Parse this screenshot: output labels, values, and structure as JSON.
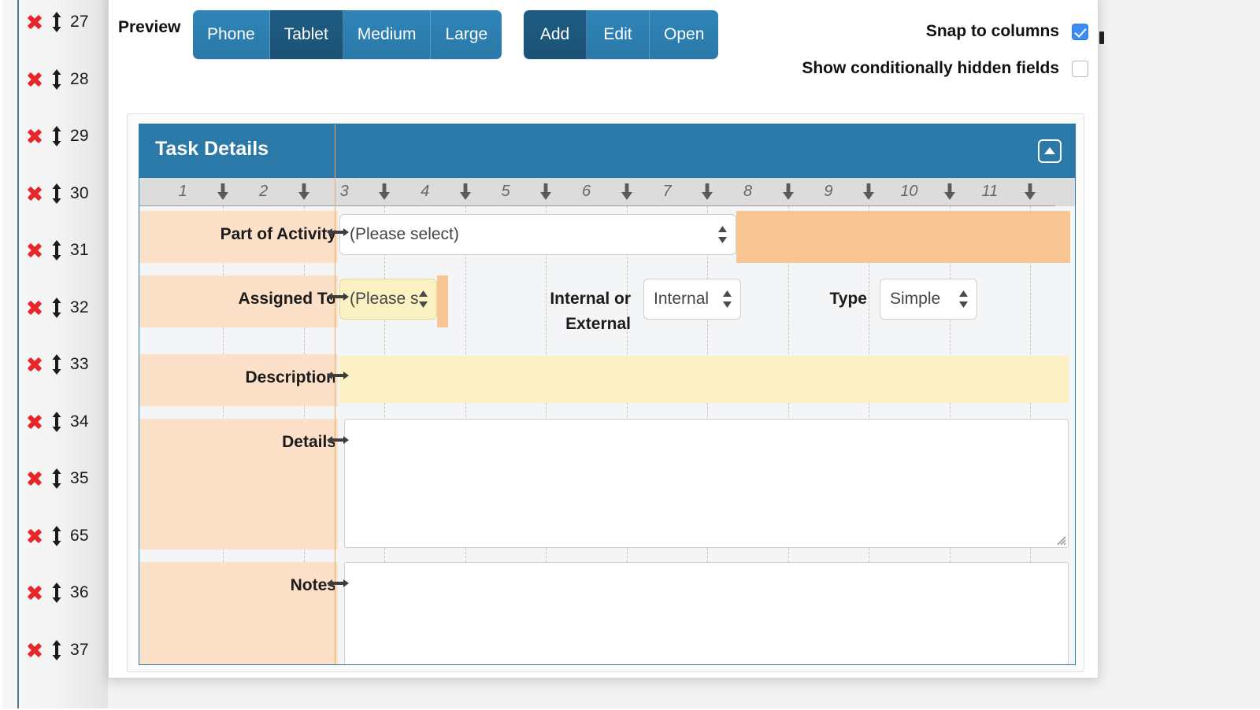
{
  "field_list": {
    "rows": [
      {
        "num": "27"
      },
      {
        "num": "28"
      },
      {
        "num": "29"
      },
      {
        "num": "30"
      },
      {
        "num": "31"
      },
      {
        "num": "32"
      },
      {
        "num": "33"
      },
      {
        "num": "34"
      },
      {
        "num": "35"
      },
      {
        "num": "65"
      },
      {
        "num": "36"
      },
      {
        "num": "37"
      }
    ],
    "delete_icon": "x-icon",
    "drag_icon": "updown-arrow-icon"
  },
  "toolbar": {
    "preview_label": "Preview",
    "size_buttons": [
      {
        "label": "Phone",
        "active": false
      },
      {
        "label": "Tablet",
        "active": true
      },
      {
        "label": "Medium",
        "active": false
      },
      {
        "label": "Large",
        "active": false
      }
    ],
    "mode_buttons": [
      {
        "label": "Add",
        "active": true
      },
      {
        "label": "Edit",
        "active": false
      },
      {
        "label": "Open",
        "active": false
      }
    ],
    "checkboxes": [
      {
        "label": "Snap to columns",
        "checked": true
      },
      {
        "label": "Show conditionally hidden fields",
        "checked": false
      }
    ],
    "accent_color": "#2a79a8",
    "accent_active_color": "#1b5276",
    "checkbox_on_color": "#3b8cf4"
  },
  "form": {
    "section_title": "Task Details",
    "collapse_icon": "collapse-up-icon",
    "header_color": "#2a79a8",
    "label_cell_color": "#fce1c8",
    "tail_fill_color": "#f9c693",
    "highlight_color": "#fbf2c4",
    "ruler": {
      "numbers": [
        "1",
        "2",
        "3",
        "4",
        "5",
        "6",
        "7",
        "8",
        "9",
        "10",
        "11"
      ],
      "handle_icon": "column-resize-arrow-icon"
    },
    "rows": [
      {
        "label": "Part of Activity",
        "control": {
          "type": "select",
          "value": "(Please select)",
          "highlight": false
        }
      },
      {
        "label": "Assigned To",
        "control": {
          "type": "select",
          "value": "(Please s",
          "highlight": true
        },
        "extra_fields": [
          {
            "label": "Internal or External",
            "type": "select",
            "value": "Internal"
          },
          {
            "label": "Type",
            "type": "select",
            "value": "Simple"
          }
        ]
      },
      {
        "label": "Description",
        "control": {
          "type": "text",
          "value": "",
          "highlight": true
        }
      },
      {
        "label": "Details",
        "control": {
          "type": "textarea",
          "value": "",
          "highlight": false
        }
      },
      {
        "label": "Notes",
        "control": {
          "type": "textarea",
          "value": "",
          "highlight": false
        }
      }
    ]
  }
}
